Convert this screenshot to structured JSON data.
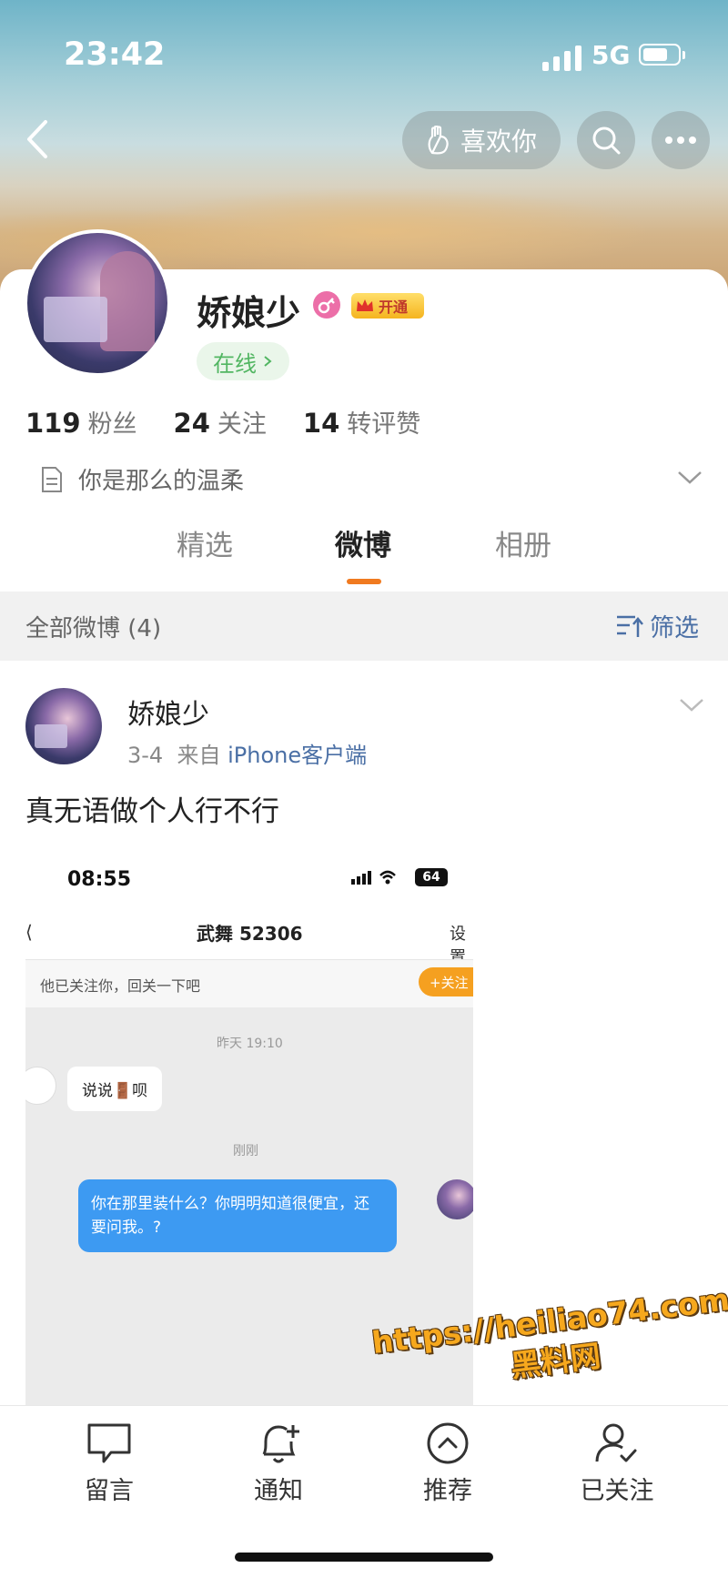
{
  "status_bar": {
    "time": "23:42",
    "network": "5G"
  },
  "header": {
    "like_label": "喜欢你"
  },
  "profile": {
    "username": "娇娘少",
    "vip_label": "开通",
    "online_label": "在线",
    "stats": [
      {
        "value": "119",
        "label": "粉丝"
      },
      {
        "value": "24",
        "label": "关注"
      },
      {
        "value": "14",
        "label": "转评赞"
      }
    ],
    "bio": "你是那么的温柔"
  },
  "tabs": [
    {
      "label": "精选",
      "active": false
    },
    {
      "label": "微博",
      "active": true
    },
    {
      "label": "相册",
      "active": false
    }
  ],
  "filter_bar": {
    "all_label": "全部微博 (4)",
    "filter_label": "筛选"
  },
  "post": {
    "author": "娇娘少",
    "date": "3-4",
    "source_prefix": "来自",
    "client": "iPhone客户端",
    "text": "真无语做个人行不行",
    "screenshot": {
      "time": "08:55",
      "battery": "64",
      "title": "武舞 52306",
      "settings": "设置",
      "follow_notice": "他已关注你，回关一下吧",
      "follow_button": "+关注",
      "timestamp1": "昨天 19:10",
      "incoming_message": "说说🚪呗",
      "timestamp2": "刚刚",
      "outgoing_message": "你在那里装什么？你明明知道很便宜，还要问我。?"
    }
  },
  "watermark": {
    "url": "https://heiliao74.com",
    "name": "黑料网"
  },
  "bottom_nav": [
    {
      "label": "留言",
      "icon": "comment-icon"
    },
    {
      "label": "通知",
      "icon": "bell-plus-icon"
    },
    {
      "label": "推荐",
      "icon": "recommend-icon"
    },
    {
      "label": "已关注",
      "icon": "user-check-icon"
    }
  ],
  "colors": {
    "accent": "#f07a20",
    "link": "#4a6fa5",
    "online": "#52b662",
    "bubble": "#3d9af2"
  }
}
